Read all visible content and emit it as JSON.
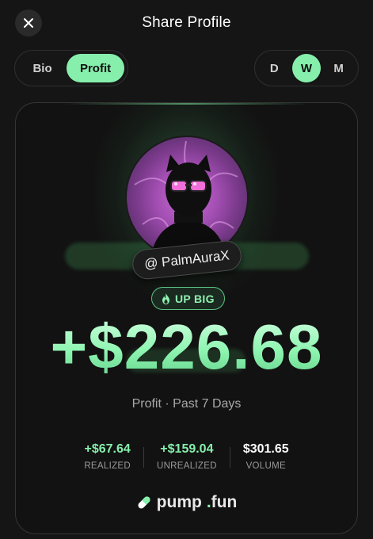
{
  "header": {
    "title": "Share Profile",
    "close_icon": "close-icon"
  },
  "tabs_left": [
    {
      "label": "Bio",
      "active": false
    },
    {
      "label": "Profit",
      "active": true
    }
  ],
  "tabs_right": [
    {
      "label": "D",
      "active": false
    },
    {
      "label": "W",
      "active": true
    },
    {
      "label": "M",
      "active": false
    }
  ],
  "card": {
    "username": "@ PalmAuraX",
    "badge": {
      "icon": "flame-icon",
      "label": "UP BIG"
    },
    "amount": "+$226.68",
    "profit_label": "Profit · Past 7 Days",
    "stats": [
      {
        "value": "+$67.64",
        "label": "REALIZED",
        "tone": "green"
      },
      {
        "value": "+$159.04",
        "label": "UNREALIZED",
        "tone": "green"
      },
      {
        "value": "$301.65",
        "label": "VOLUME",
        "tone": "white"
      }
    ],
    "brand": {
      "name_a": "pump",
      "dot": ".",
      "name_b": "fun",
      "icon": "pill-icon"
    }
  },
  "colors": {
    "accent": "#86efac",
    "background": "#151515",
    "card": "#121212"
  }
}
